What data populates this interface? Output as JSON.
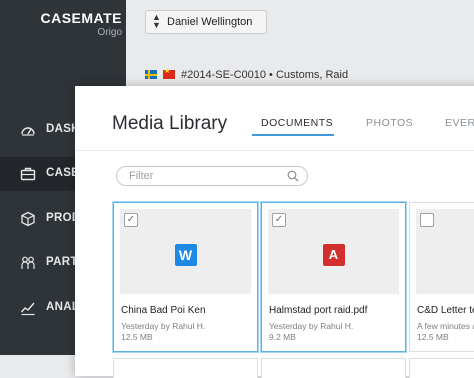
{
  "brand": {
    "name": "CASEMATE",
    "sub": "Origo"
  },
  "sidebar": {
    "items": [
      {
        "label": "DASHE",
        "icon": "gauge-icon",
        "active": false
      },
      {
        "label": "CASES",
        "icon": "briefcase-icon",
        "active": true
      },
      {
        "label": "PRODU",
        "icon": "cube-icon",
        "active": false
      },
      {
        "label": "PARTI",
        "icon": "people-icon",
        "active": false
      },
      {
        "label": "ANALY",
        "icon": "chart-icon",
        "active": false
      }
    ]
  },
  "case_selector": {
    "value": "Daniel Wellington"
  },
  "case_info": {
    "flags": [
      "SE",
      "CN"
    ],
    "text": "#2014-SE-C0010  •  Customs, Raid"
  },
  "modal": {
    "title": "Media Library",
    "tabs": [
      {
        "label": "DOCUMENTS",
        "active": true
      },
      {
        "label": "PHOTOS",
        "active": false
      },
      {
        "label": "EVERY",
        "active": false
      }
    ],
    "filter": {
      "placeholder": "Filter",
      "value": ""
    },
    "files": [
      {
        "name": "China Bad Poi Ken",
        "meta1": "Yesterday by Rahul H.",
        "meta2": "12.5 MB",
        "type": "word",
        "icon_glyph": "W",
        "checked": true,
        "selected": true
      },
      {
        "name": "Halmstad port raid.pdf",
        "meta1": "Yesterday by Rahul H.",
        "meta2": "9.2 MB",
        "type": "pdf",
        "icon_glyph": "A",
        "checked": true,
        "selected": true
      },
      {
        "name": "C&D Letter te",
        "meta1": "A few minutes a",
        "meta2": "12.5 MB",
        "type": "blank",
        "icon_glyph": "",
        "checked": false,
        "selected": false
      }
    ]
  },
  "colors": {
    "accent": "#3b9ad9",
    "sidebar": "#2f3439",
    "word": "#1e88e5",
    "pdf": "#d32f2f"
  }
}
